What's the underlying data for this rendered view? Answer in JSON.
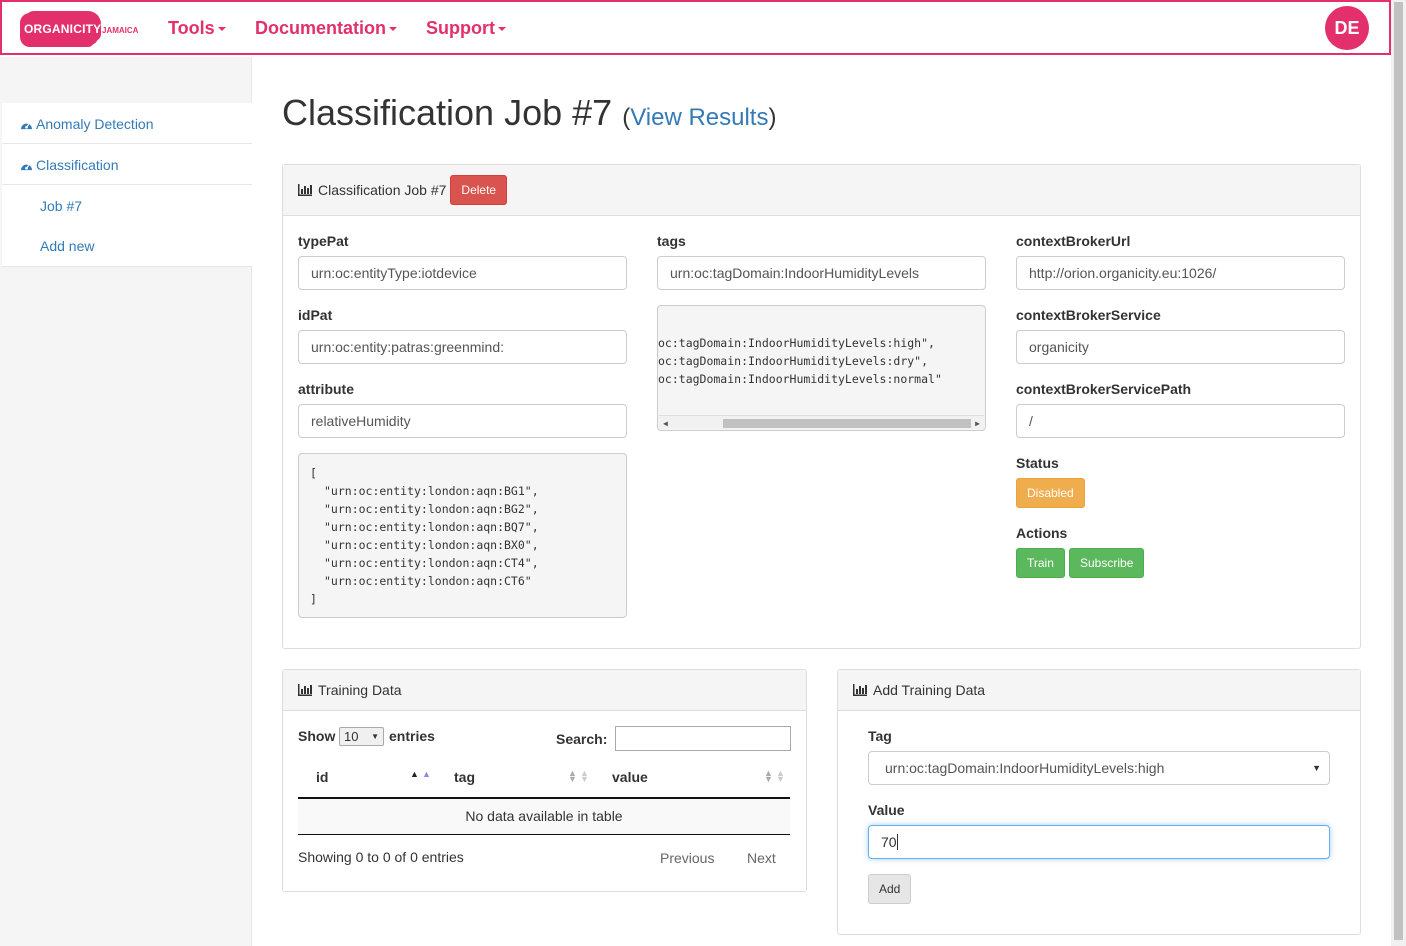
{
  "nav": {
    "brand": "ORGANICITY",
    "brand_sub": "JAMAICA",
    "items": [
      "Tools",
      "Documentation",
      "Support"
    ],
    "avatar": "DE",
    "accent": "#e3306c"
  },
  "sidebar": {
    "items": [
      {
        "label": "Anomaly Detection",
        "icon": "dashboard-icon"
      },
      {
        "label": "Classification",
        "icon": "dashboard-icon"
      }
    ],
    "subitems": [
      "Job #7",
      "Add new"
    ]
  },
  "page": {
    "title": "Classification Job #7",
    "link_open": "(",
    "link": "View Results",
    "link_close": ")"
  },
  "job_panel": {
    "heading": "Classification Job #7",
    "delete_label": "Delete",
    "typePat_label": "typePat",
    "typePat_value": "urn:oc:entityType:iotdevice",
    "idPat_label": "idPat",
    "idPat_value": "urn:oc:entity:patras:greenmind:",
    "attribute_label": "attribute",
    "attribute_value": "relativeHumidity",
    "entities_open": "[",
    "entities": [
      "\"urn:oc:entity:london:aqn:BG1\",",
      "\"urn:oc:entity:london:aqn:BG2\",",
      "\"urn:oc:entity:london:aqn:BQ7\",",
      "\"urn:oc:entity:london:aqn:BX0\",",
      "\"urn:oc:entity:london:aqn:CT4\",",
      "\"urn:oc:entity:london:aqn:CT6\""
    ],
    "entities_close": "]",
    "tags_label": "tags",
    "tags_value": "urn:oc:tagDomain:IndoorHumidityLevels",
    "tag_lines": [
      "oc:tagDomain:IndoorHumidityLevels:high\",",
      "oc:tagDomain:IndoorHumidityLevels:dry\",",
      "oc:tagDomain:IndoorHumidityLevels:normal\""
    ],
    "cb_url_label": "contextBrokerUrl",
    "cb_url_value": "http://orion.organicity.eu:1026/",
    "cb_service_label": "contextBrokerService",
    "cb_service_value": "organicity",
    "cb_path_label": "contextBrokerServicePath",
    "cb_path_value": "/",
    "status_label": "Status",
    "status_value": "Disabled",
    "actions_label": "Actions",
    "train_label": "Train",
    "subscribe_label": "Subscribe"
  },
  "training_panel": {
    "heading": "Training Data",
    "show_label": "Show",
    "entries_select": "10",
    "entries_label": "entries",
    "search_label": "Search:",
    "columns": [
      "id",
      "tag",
      "value"
    ],
    "empty": "No data available in table",
    "info": "Showing 0 to 0 of 0 entries",
    "previous": "Previous",
    "next": "Next"
  },
  "add_panel": {
    "heading": "Add Training Data",
    "tag_label": "Tag",
    "tag_value": "urn:oc:tagDomain:IndoorHumidityLevels:high",
    "value_label": "Value",
    "value_value": "70",
    "add_label": "Add"
  }
}
